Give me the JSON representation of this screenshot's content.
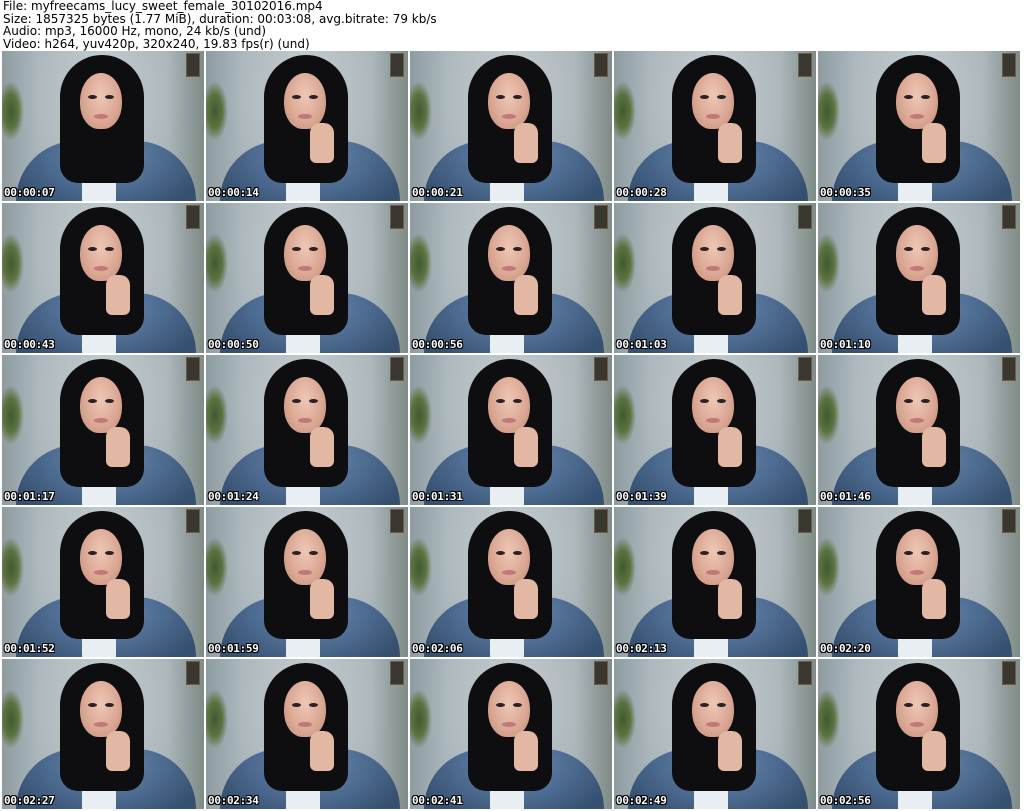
{
  "header": {
    "file_line": "File: myfreecams_lucy_sweet_female_30102016.mp4",
    "size_line": "Size: 1857325 bytes (1.77 MiB), duration: 00:03:08, avg.bitrate: 79 kb/s",
    "audio_line": "Audio: mp3, 16000 Hz, mono, 24 kb/s (und)",
    "video_line": "Video: h264, yuv420p, 320x240, 19.83 fps(r) (und)"
  },
  "thumbnails": [
    {
      "timestamp": "00:00:07"
    },
    {
      "timestamp": "00:00:14"
    },
    {
      "timestamp": "00:00:21"
    },
    {
      "timestamp": "00:00:28"
    },
    {
      "timestamp": "00:00:35"
    },
    {
      "timestamp": "00:00:43"
    },
    {
      "timestamp": "00:00:50"
    },
    {
      "timestamp": "00:00:56"
    },
    {
      "timestamp": "00:01:03"
    },
    {
      "timestamp": "00:01:10"
    },
    {
      "timestamp": "00:01:17"
    },
    {
      "timestamp": "00:01:24"
    },
    {
      "timestamp": "00:01:31"
    },
    {
      "timestamp": "00:01:39"
    },
    {
      "timestamp": "00:01:46"
    },
    {
      "timestamp": "00:01:52"
    },
    {
      "timestamp": "00:01:59"
    },
    {
      "timestamp": "00:02:06"
    },
    {
      "timestamp": "00:02:13"
    },
    {
      "timestamp": "00:02:20"
    },
    {
      "timestamp": "00:02:27"
    },
    {
      "timestamp": "00:02:34"
    },
    {
      "timestamp": "00:02:41"
    },
    {
      "timestamp": "00:02:49"
    },
    {
      "timestamp": "00:02:56"
    }
  ],
  "colors": {
    "background": "#ffffff",
    "header_text": "#000000",
    "timestamp_text": "#ffffff",
    "timestamp_outline": "#000000"
  }
}
